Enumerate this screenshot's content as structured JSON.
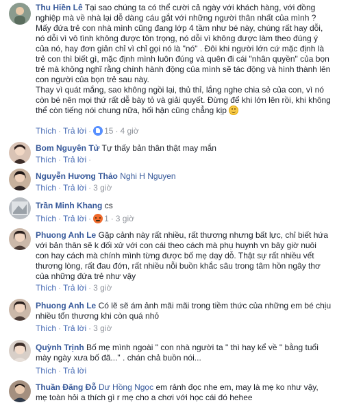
{
  "actions": {
    "like_label": "Thích",
    "reply_label": "Trả lời",
    "separator": "·"
  },
  "comments": [
    {
      "author": "Thu Hiền Lê",
      "mention": "",
      "text": "Tại sao chúng ta có thể cười cả ngày với khách hàng, với đồng nghiệp mà về nhà lại dễ dàng cáu gắt với những người thân nhất của mình ?\nMấy đứa trẻ con nhà mình cũng đang lớp 4 tầm như bé này, chúng rất hay dỗi, nó dỗi vì vô tình không được tôn trọng, nó dỗi vì không được làm theo đúng ý của nó, hay đơn giản chỉ vì chỉ gọi nó là \"nó\" . Đôi khi người lớn cứ mặc định là trẻ con thì biết gì, mặc định mình luôn đúng và quên đi cái \"nhân quyền\" của bọn trẻ mà không nghĩ rằng chính hành động của mình sẽ tác động và hình thành lên con người của bọn trẻ sau này.\nThay vì quát mắng, sao không ngồi lại, thủ thỉ, lắng nghe chia sẻ của con, vì nó còn bé nên mọi thứ rất dễ bày tỏ và giải quyết. Đừng để khi lớn lên rồi, khi không thể còn tiếng nói chung nữa, hối hận cũng chẳng kịp",
      "emoji": "smile",
      "reaction": "like",
      "reaction_count": "15",
      "time": "4 giờ"
    },
    {
      "author": "Bom Nguyên Tử",
      "mention": "",
      "text": "Tự thấy bản thân thật may mắn",
      "emoji": "",
      "reaction": "",
      "reaction_count": "",
      "time": ""
    },
    {
      "author": "Nguyễn Hương Thảo",
      "mention": "",
      "text": "Nghi H Nguyen",
      "emoji": "",
      "reaction": "",
      "reaction_count": "",
      "time": "3 giờ"
    },
    {
      "author": "Trần Minh Khang",
      "mention": "",
      "text": "cs",
      "emoji": "",
      "reaction": "angry",
      "reaction_count": "1",
      "time": "3 giờ"
    },
    {
      "author": "Phuong Anh Le",
      "mention": "",
      "text": "Gặp cảnh này rất nhiều, rất thương nhưng bất lực, chỉ biết hứa với bản thân sẽ k đối xử với con cái theo cách mà phụ huynh vn bây giờ nuôi con hay cách mà chính mình từng được bố mẹ dạy dỗ. Thật sự rất nhiều vết thương lòng, rất đau đớn, rất nhiều nỗi buồn khắc sâu trong tâm hồn ngây thơ của những đứa trẻ như vậy",
      "emoji": "",
      "reaction": "",
      "reaction_count": "",
      "time": "3 giờ"
    },
    {
      "author": "Phuong Anh Le",
      "mention": "",
      "text": "Có lẽ sẽ ám ảnh mãi mãi trong tiềm thức của những em bé chịu nhiều tổn thương khi còn quá nhỏ",
      "emoji": "",
      "reaction": "",
      "reaction_count": "",
      "time": "3 giờ"
    },
    {
      "author": "Quỳnh Trịnh",
      "mention": "",
      "text": "Bố mẹ mình ngoài \" con nhà người ta \" thì hay kể về \" bằng tuổi mày ngày xưa bố đã...\" . chán chả buồn nói...",
      "emoji": "",
      "reaction": "",
      "reaction_count": "",
      "time": ""
    },
    {
      "author": "Thuần Đăng Đỗ",
      "mention": "Dư Hồng Ngọc",
      "text": "em rảnh đọc nhe em, may là mẹ ko như vậy, mẹ toàn hỏi a thích gì r mẹ cho a chơi với học cái đó hehee",
      "emoji": "",
      "reaction": "",
      "reaction_count": "",
      "time": ""
    }
  ],
  "colors": {
    "name": "#365899",
    "link": "#4267b2",
    "meta": "#90949c",
    "text": "#1d2129"
  }
}
